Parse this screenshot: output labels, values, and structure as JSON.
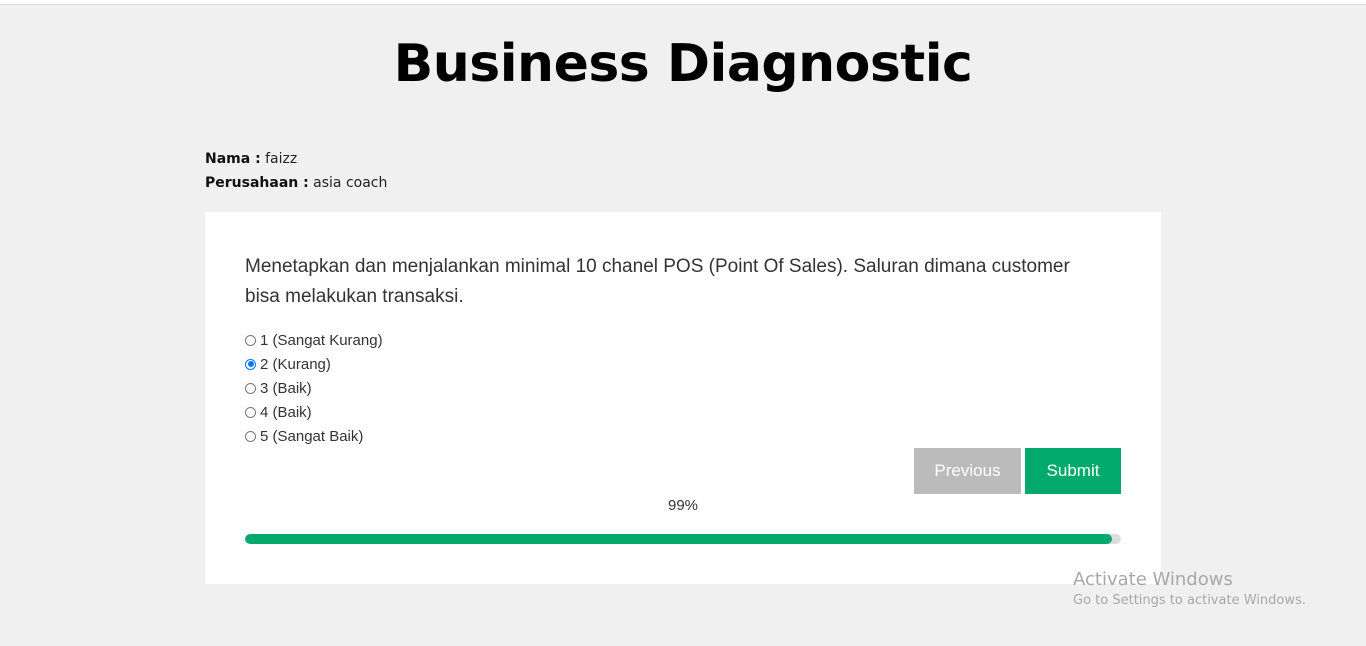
{
  "header": {
    "title": "Business Diagnostic"
  },
  "info": {
    "nama_label": "Nama :",
    "nama_value": "faizz",
    "perusahaan_label": "Perusahaan :",
    "perusahaan_value": "asia coach"
  },
  "question": {
    "text": "Menetapkan dan menjalankan minimal 10 chanel POS (Point Of Sales). Saluran dimana customer bisa melakukan transaksi.",
    "selected_index": 1,
    "options": [
      {
        "label": "1 (Sangat Kurang)",
        "checked": false
      },
      {
        "label": "2 (Kurang)",
        "checked": true
      },
      {
        "label": "3 (Baik)",
        "checked": false
      },
      {
        "label": "4 (Baik)",
        "checked": false
      },
      {
        "label": "5 (Sangat Baik)",
        "checked": false
      }
    ]
  },
  "buttons": {
    "previous": "Previous",
    "submit": "Submit"
  },
  "progress": {
    "label": "99%",
    "percent": 99
  },
  "colors": {
    "accent": "#04aa6d",
    "previous_bg": "#bbbbbb",
    "background": "#f0f0f0"
  },
  "watermark": {
    "title": "Activate Windows",
    "subtitle": "Go to Settings to activate Windows."
  }
}
